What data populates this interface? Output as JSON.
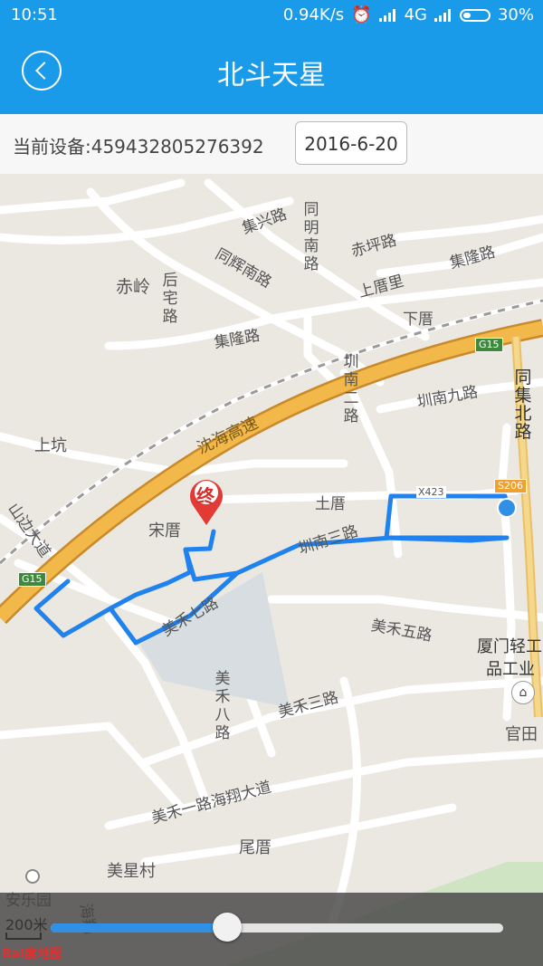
{
  "status_bar": {
    "time": "10:51",
    "speed": "0.94K/s",
    "network": "4G",
    "battery": "30%"
  },
  "header": {
    "title": "北斗天星"
  },
  "device": {
    "label": "当前设备:459432805276392",
    "date": "2016-6-20"
  },
  "map": {
    "labels": {
      "jixing": "集兴路",
      "tongming": "同明南路",
      "chiping": "赤坪路",
      "jilong_top": "集隆路",
      "tonghui": "同辉南路",
      "chiling": "赤岭",
      "houzhai": "后宅路",
      "shangcuoli": "上厝里",
      "xiacuo": "下厝",
      "jilong": "集隆路",
      "zhennan2": "圳南二路",
      "zhennan9": "圳南九路",
      "tongji": "同集北路",
      "shangkeng": "上坑",
      "tucuo": "土厝",
      "songcuo": "宋厝",
      "zhennan3": "圳南三路",
      "meihe7": "美禾七路",
      "meihe5": "美禾五路",
      "xiamen": "厦门轻工",
      "pingongye": "品工业",
      "meihe8": "美禾八路",
      "meihe3": "美禾三路",
      "guantian": "官田",
      "meihe1": "美禾一路海翔大道",
      "weicuo": "尾厝",
      "meixing": "美星村",
      "anle": "安乐园",
      "shanbian": "山边大道",
      "haixiang": "海翔"
    },
    "highway": {
      "name": "沈海高速",
      "shield": "G15",
      "shield2": "G15",
      "shield3": "S206",
      "county": "X423"
    },
    "marker": "终",
    "scale": "200米",
    "logo": "Bai度地图"
  },
  "player": {
    "progress": 0.39
  }
}
